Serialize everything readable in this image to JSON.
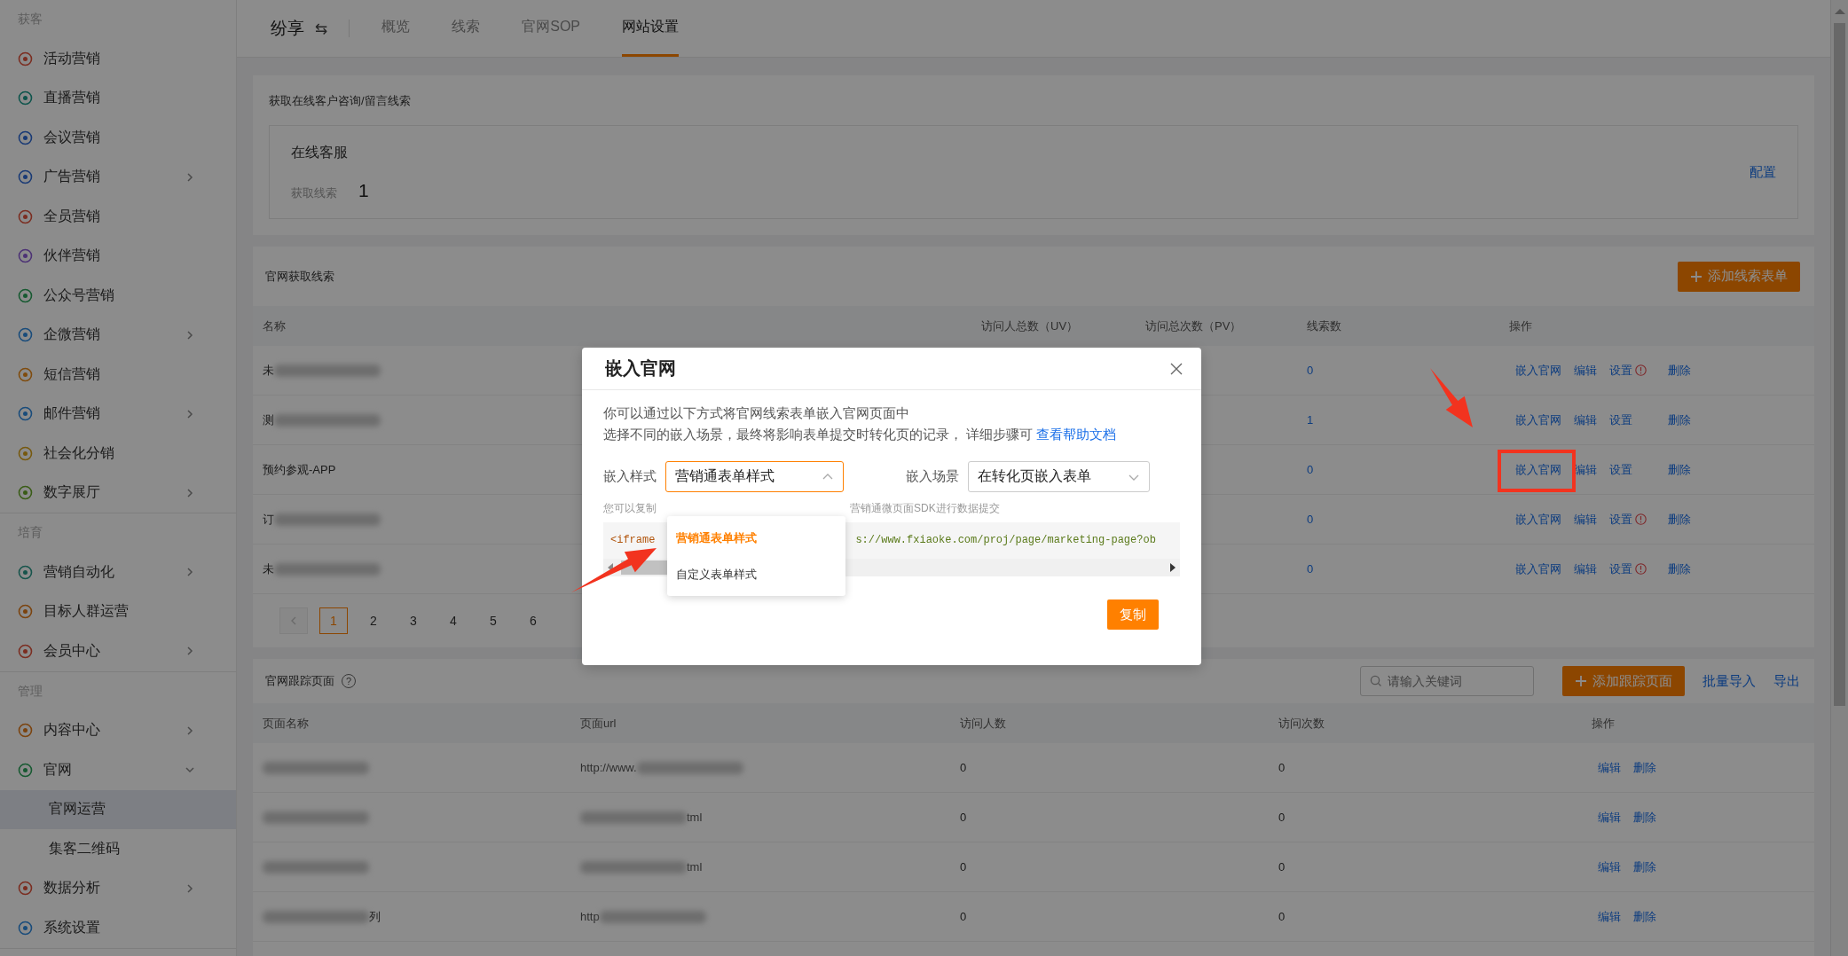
{
  "sidebar": {
    "sections": [
      {
        "title": "获客",
        "items": [
          {
            "label": "活动营销",
            "kind": "link",
            "selected": false
          },
          {
            "label": "直播营销",
            "kind": "link",
            "selected": false
          },
          {
            "label": "会议营销",
            "kind": "link",
            "selected": false
          },
          {
            "label": "广告营销",
            "kind": "group",
            "expanded": false,
            "selected": false
          },
          {
            "label": "全员营销",
            "kind": "link",
            "selected": false
          },
          {
            "label": "伙伴营销",
            "kind": "link",
            "selected": false
          },
          {
            "label": "公众号营销",
            "kind": "link",
            "selected": false
          },
          {
            "label": "企微营销",
            "kind": "group",
            "expanded": false,
            "selected": false
          },
          {
            "label": "短信营销",
            "kind": "link",
            "selected": false
          },
          {
            "label": "邮件营销",
            "kind": "group",
            "expanded": false,
            "selected": false
          },
          {
            "label": "社会化分销",
            "kind": "link",
            "selected": false
          },
          {
            "label": "数字展厅",
            "kind": "group",
            "expanded": false,
            "selected": false
          }
        ]
      },
      {
        "title": "培育",
        "items": [
          {
            "label": "营销自动化",
            "kind": "group",
            "expanded": false,
            "selected": false
          },
          {
            "label": "目标人群运营",
            "kind": "link",
            "selected": false
          },
          {
            "label": "会员中心",
            "kind": "group",
            "expanded": false,
            "selected": false
          }
        ]
      },
      {
        "title": "管理",
        "items": [
          {
            "label": "内容中心",
            "kind": "group",
            "expanded": false,
            "selected": false
          },
          {
            "label": "官网",
            "kind": "group",
            "expanded": true,
            "selected": false,
            "children": [
              {
                "label": "官网运营",
                "selected": true
              },
              {
                "label": "集客二维码",
                "selected": false
              }
            ]
          },
          {
            "label": "数据分析",
            "kind": "group",
            "expanded": false,
            "selected": false
          },
          {
            "label": "系统设置",
            "kind": "link",
            "selected": false
          }
        ]
      }
    ]
  },
  "topbar": {
    "brand": "纷享",
    "switch_icon": "⇆",
    "tabs": [
      {
        "label": "概览",
        "selected": false
      },
      {
        "label": "线索",
        "selected": false
      },
      {
        "label": "官网SOP",
        "selected": false
      },
      {
        "label": "网站设置",
        "selected": true
      }
    ]
  },
  "online_card": {
    "title": "获取在线客户咨询/留言线索",
    "service_name": "在线客服",
    "stat_label": "获取线索",
    "stat_value": "1",
    "config_link": "配置"
  },
  "leads_card": {
    "title": "官网获取线索",
    "add_button": "添加线索表单",
    "columns": [
      "名称",
      "访问人总数（UV）",
      "访问总次数（PV）",
      "线索数",
      "操作"
    ],
    "rows": [
      {
        "name": "未",
        "redacted": true,
        "lead_count": "0",
        "actions": [
          {
            "label": "嵌入官网"
          },
          {
            "label": "编辑"
          },
          {
            "label": "设置",
            "warning": true
          },
          {
            "label": "删除"
          }
        ]
      },
      {
        "name": "测",
        "redacted": true,
        "lead_count": "1",
        "actions": [
          {
            "label": "嵌入官网"
          },
          {
            "label": "编辑"
          },
          {
            "label": "设置",
            "warning": false
          },
          {
            "label": "删除"
          }
        ]
      },
      {
        "name": "预约参观-APP",
        "redacted": false,
        "lead_count": "0",
        "actions": [
          {
            "label": "嵌入官网"
          },
          {
            "label": "编辑"
          },
          {
            "label": "设置",
            "warning": false
          },
          {
            "label": "删除"
          }
        ]
      },
      {
        "name": "订",
        "redacted": true,
        "lead_count": "0",
        "actions": [
          {
            "label": "嵌入官网"
          },
          {
            "label": "编辑"
          },
          {
            "label": "设置",
            "warning": true
          },
          {
            "label": "删除"
          }
        ]
      },
      {
        "name": "未",
        "redacted": true,
        "lead_count": "0",
        "actions": [
          {
            "label": "嵌入官网"
          },
          {
            "label": "编辑"
          },
          {
            "label": "设置",
            "warning": true
          },
          {
            "label": "删除"
          }
        ]
      }
    ],
    "pagination": {
      "prev_disabled": true,
      "pages": [
        {
          "label": "1",
          "selected": true
        },
        {
          "label": "2",
          "selected": false
        },
        {
          "label": "3",
          "selected": false
        },
        {
          "label": "4",
          "selected": false
        },
        {
          "label": "5",
          "selected": false
        },
        {
          "label": "6",
          "selected": false
        }
      ]
    }
  },
  "track_card": {
    "title": "官网跟踪页面",
    "help_icon": "?",
    "search": {
      "placeholder": "请输入关键词"
    },
    "add_button": "添加跟踪页面",
    "import_link": "批量导入",
    "export_link": "导出",
    "columns": [
      "页面名称",
      "页面url",
      "访问人数",
      "访问次数",
      "操作"
    ],
    "rows": [
      {
        "name": {
          "redacted": true
        },
        "url": {
          "before": "http://www.",
          "redacted": true
        },
        "visitors": "0",
        "visits": "0",
        "actions": [
          "编辑",
          "删除"
        ]
      },
      {
        "name": {
          "redacted": true
        },
        "url": {
          "redacted": true,
          "after": "tml"
        },
        "visitors": "0",
        "visits": "0",
        "actions": [
          "编辑",
          "删除"
        ]
      },
      {
        "name": {
          "redacted": true
        },
        "url": {
          "redacted": true,
          "after": "tml"
        },
        "visitors": "0",
        "visits": "0",
        "actions": [
          "编辑",
          "删除"
        ]
      },
      {
        "name": {
          "redacted": true,
          "after": "列"
        },
        "url": {
          "before": "http",
          "redacted": true
        },
        "visitors": "0",
        "visits": "0",
        "actions": [
          "编辑",
          "删除"
        ]
      }
    ]
  },
  "modal": {
    "title": "嵌入官网",
    "intro": "你可以通过以下方式将官网线索表单嵌入官网页面中",
    "intro2": "选择不同的嵌入场景，最终将影响表单提交时转化页的记录， 详细步骤可",
    "help_link": "查看帮助文档",
    "style_field": {
      "label": "嵌入样式",
      "value": "营销通表单样式",
      "open": true
    },
    "scene_field": {
      "label": "嵌入场景",
      "value": "在转化页嵌入表单",
      "open": false
    },
    "hint_start": "您可以复制",
    "hint_end": "营销通微页面SDK进行数据提交",
    "code_start": "<iframe",
    "code_end": "s://www.fxiaoke.com/proj/page/marketing-page?ob",
    "options": [
      {
        "label": "营销通表单样式",
        "selected": true
      },
      {
        "label": "自定义表单样式",
        "selected": false
      }
    ],
    "copy_button": "复制"
  }
}
